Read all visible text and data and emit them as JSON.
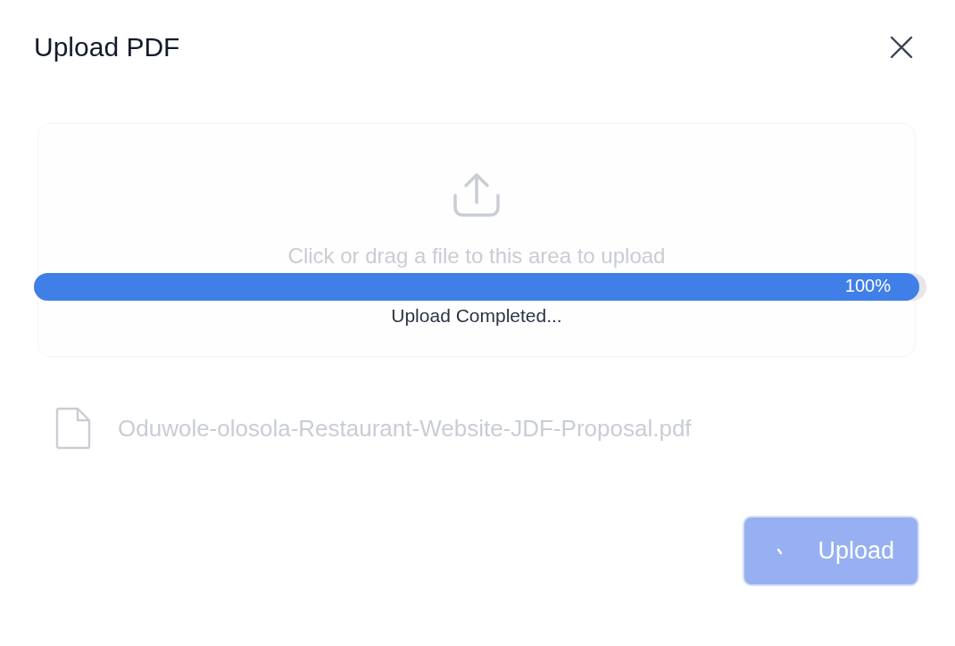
{
  "dialog": {
    "title": "Upload PDF"
  },
  "dropzone": {
    "hint": "Click or drag a file to this area to upload",
    "disabled": true
  },
  "progress": {
    "level": 1.0,
    "reading": "100%",
    "status": "Upload Completed..."
  },
  "file": {
    "name": "Oduwole-olosola-Restaurant-Website-JDF-Proposal.pdf",
    "disabled": true
  },
  "upload_button": {
    "label": "Upload",
    "disabled": true,
    "loading": true
  }
}
